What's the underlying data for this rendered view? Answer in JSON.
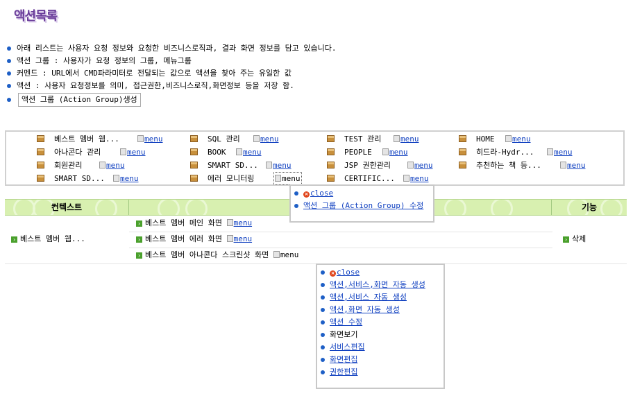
{
  "page": {
    "title": "액션목록"
  },
  "info": {
    "lines": [
      "아래 리스트는 사용자 요청 정보와 요청한 비즈니스로직과, 결과 화면 정보를 담고 있습니다.",
      "액션 그룹 : 사용자가 요청 정보의 그룹, 메뉴그룹",
      "커멘드 : URL에서 CMD파라미터로 전달되는 값으로 액션을 찾아 주는 유일한 값",
      "액션 : 사용자 요청정보를 의미, 접근권한,비즈니스로직,화면정보 등을 저장 함."
    ],
    "create_button": "액션 그룹 (Action Group)생성"
  },
  "groups": {
    "menu_label": "menu",
    "items": [
      "베스트 멤버 웹...",
      "SQL 관리",
      "TEST 관리",
      "HOME",
      "아나콘다 관리",
      "BOOK",
      "PEOPLE",
      "히드라-Hydr...",
      "회원관리",
      "SMART SD...",
      "JSP 권한관리",
      "추천하는 책 등...",
      "SMART SD...",
      "에러 모니터링",
      "CERTIFIC..."
    ]
  },
  "group_popup": {
    "close": "close",
    "edit": "액션 그룹 (Action Group) 수정"
  },
  "table": {
    "headers": {
      "context": "컨텍스트",
      "action": "",
      "function": "기능"
    },
    "context": "베스트 멤버 웹...",
    "rows": [
      "베스트 멤버 메인 화면",
      "베스트 멤버 에러 화면",
      "베스트 멤버 아나콘다 스크린샷 화면"
    ],
    "delete": "삭제",
    "menu_label": "menu"
  },
  "action_popup": {
    "close": "close",
    "items": [
      "액션,서비스,화면 자동 생성",
      "액션,서비스 자동 생성",
      "액션,화면 자동 생성",
      "액션 수정",
      "화면보기",
      "서비스편집",
      "화면편집",
      "권한편집"
    ]
  },
  "colors": {
    "title": "#6a3d9a",
    "link": "#1040c0",
    "header_bg": "#d8f0b0",
    "bullet": "#1e5fc6"
  }
}
